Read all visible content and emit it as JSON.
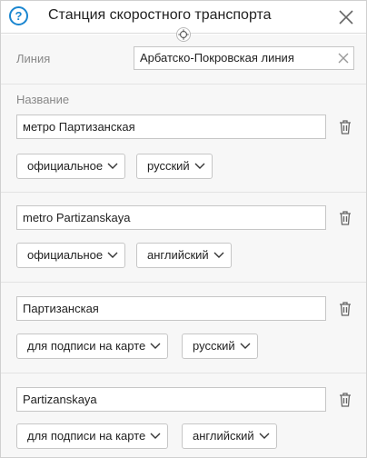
{
  "header": {
    "title": "Станция скоростного транспорта",
    "help_icon_glyph": "?"
  },
  "line": {
    "label": "Линия",
    "value": "Арбатско-Покровская линия"
  },
  "names": {
    "label": "Название",
    "items": [
      {
        "value": "метро Партизанская",
        "type": "официальное",
        "language": "русский"
      },
      {
        "value": "metro Partizanskaya",
        "type": "официальное",
        "language": "английский"
      },
      {
        "value": "Партизанская",
        "type": "для подписи на карте",
        "language": "русский"
      },
      {
        "value": "Partizanskaya",
        "type": "для подписи на карте",
        "language": "английский"
      }
    ]
  },
  "colors": {
    "accent": "#1a86d0",
    "border": "#c6c6c6",
    "background": "#f7f7f7"
  }
}
